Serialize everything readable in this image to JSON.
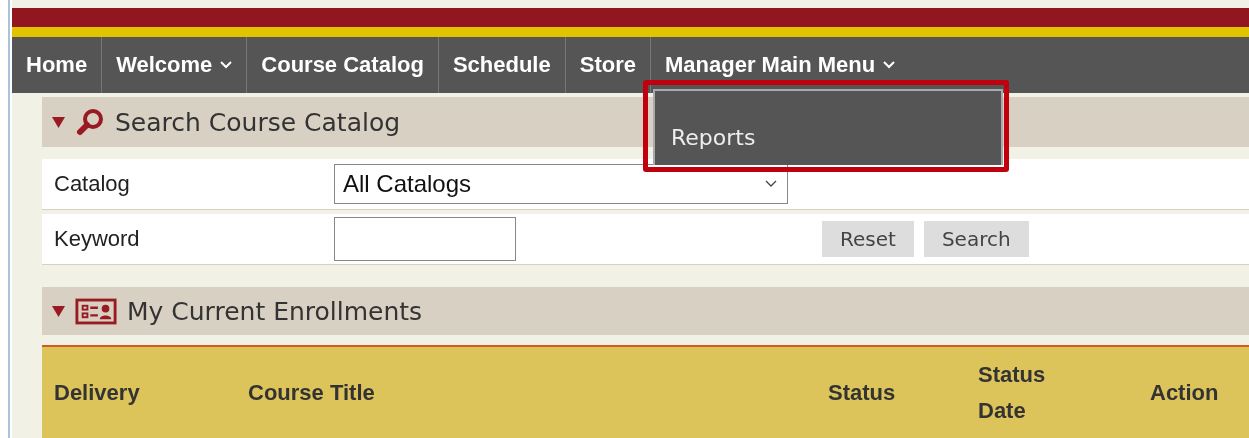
{
  "nav": [
    {
      "label": "Home",
      "kind": "link"
    },
    {
      "label": "Welcome",
      "kind": "menu"
    },
    {
      "label": "Course Catalog",
      "kind": "link"
    },
    {
      "label": "Schedule",
      "kind": "link"
    },
    {
      "label": "Store",
      "kind": "link"
    },
    {
      "label": "Manager Main Menu",
      "kind": "menu",
      "items": [
        "Reports"
      ],
      "highlighted": true
    }
  ],
  "search_panel": {
    "title": "Search Course Catalog",
    "expanded": true,
    "fields": [
      {
        "label": "Catalog",
        "kind": "select",
        "value": "All Catalogs"
      },
      {
        "label": "Keyword",
        "kind": "text"
      }
    ],
    "buttons": [
      "Reset",
      "Search"
    ]
  },
  "enrollments_panel": {
    "title": "My Current Enrollments",
    "expanded": true,
    "columns": [
      "Delivery",
      "Course Title",
      "Status",
      "Status Date",
      "Action"
    ]
  }
}
